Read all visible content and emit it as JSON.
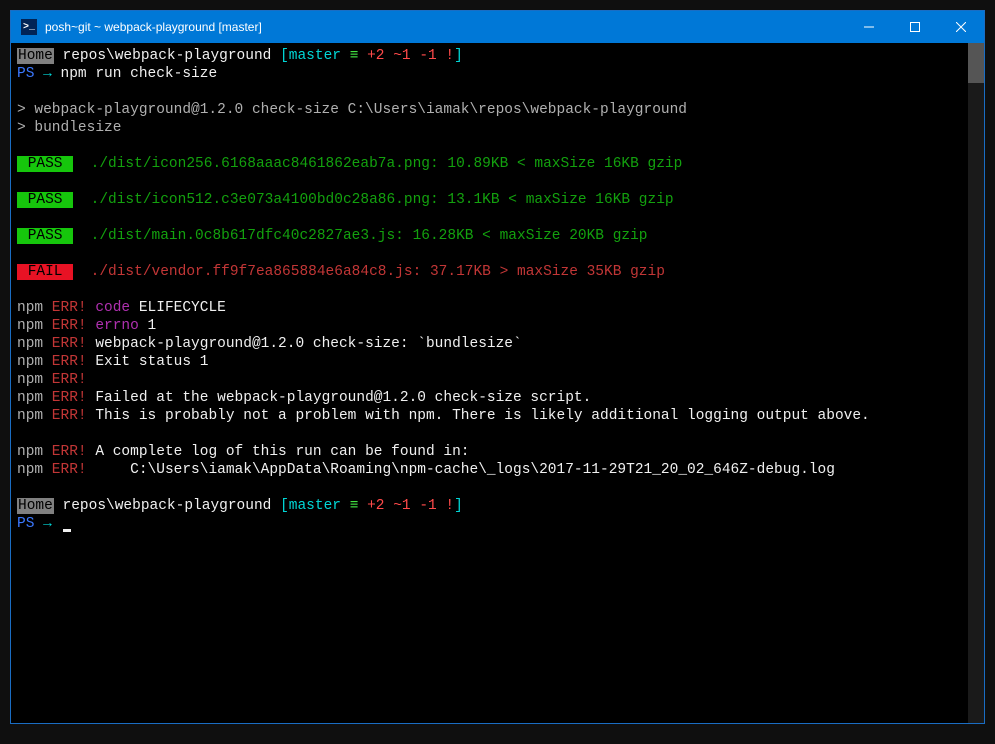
{
  "window": {
    "title": "posh~git ~ webpack-playground [master]"
  },
  "prompt1": {
    "home": "Home",
    "path": " repos\\webpack-playground ",
    "br_open": "[",
    "branch": "master",
    "equiv": " ≡ ",
    "ahead": "+2",
    "sep1": " ",
    "behind": "~1",
    "sep2": " ",
    "staged": "-1",
    "sep3": " ",
    "bang": "!",
    "br_close": "]"
  },
  "prompt2": {
    "ps": "PS",
    "arrow": " → ",
    "cmd": "npm run check-size"
  },
  "npm_script": {
    "line1": "> webpack-playground@1.2.0 check-size C:\\Users\\iamak\\repos\\webpack-playground",
    "line2": "> bundlesize"
  },
  "results": [
    {
      "badge": " PASS ",
      "pass": true,
      "text": "  ./dist/icon256.6168aaac8461862eab7a.png: 10.89KB < maxSize 16KB gzip"
    },
    {
      "badge": " PASS ",
      "pass": true,
      "text": "  ./dist/icon512.c3e073a4100bd0c28a86.png: 13.1KB < maxSize 16KB gzip"
    },
    {
      "badge": " PASS ",
      "pass": true,
      "text": "  ./dist/main.0c8b617dfc40c2827ae3.js: 16.28KB < maxSize 20KB gzip"
    },
    {
      "badge": " FAIL ",
      "pass": false,
      "text": "  ./dist/vendor.ff9f7ea865884e6a84c8.js: 37.17KB > maxSize 35KB gzip"
    }
  ],
  "err": {
    "npm": "npm",
    "err": " ERR!",
    "code_label": " code",
    "code_val": " ELIFECYCLE",
    "errno_label": " errno",
    "errno_val": " 1",
    "script": " webpack-playground@1.2.0 check-size: `bundlesize`",
    "exit": " Exit status 1",
    "failed": " Failed at the webpack-playground@1.2.0 check-size script.",
    "probably": " This is probably not a problem with npm. There is likely additional logging output above.",
    "loglabel": " A complete log of this run can be found in:",
    "logpath": "     C:\\Users\\iamak\\AppData\\Roaming\\npm-cache\\_logs\\2017-11-29T21_20_02_646Z-debug.log"
  },
  "prompt3": {
    "ps": "PS",
    "arrow": " → "
  }
}
